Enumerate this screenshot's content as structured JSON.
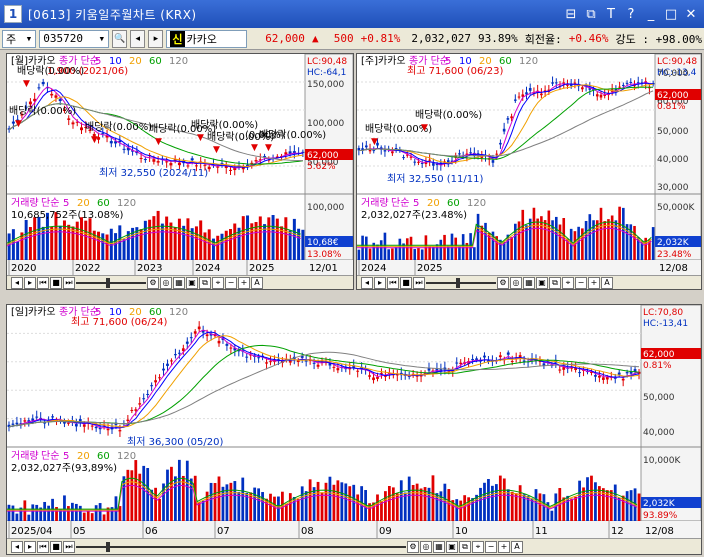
{
  "window": {
    "title": "[0613] 키움일주월차트 (KRX)",
    "app_icon": "1"
  },
  "toolbar": {
    "mode": "주",
    "code": "035720",
    "name": "카카오",
    "name_badge": "신",
    "price": "62,000",
    "arrow": "▲",
    "change": "500",
    "change_pct": "+0.81%",
    "volume": "2,032,027",
    "vol_ratio": "93.89%",
    "turnover_label": "회전율:",
    "turnover": "+0.46%",
    "strength": "강도 : +98.00%"
  },
  "colors": {
    "up": "#e00000",
    "down": "#0030c0",
    "ma5": "#d000d0",
    "ma10": "#0000ff",
    "ma20": "#f0a000",
    "ma60": "#00a000",
    "ma120": "#808080"
  },
  "panels": {
    "monthly": {
      "legend": "[월]카카오",
      "ma_label": "종가 단순",
      "ma": [
        "5",
        "10",
        "20",
        "60",
        "120"
      ],
      "hi_text": "1,900 (2021/06)",
      "lc": "LC:90,48",
      "hc": "HC:-64,1",
      "axis": [
        "150,000",
        "100,000",
        "50,000"
      ],
      "price_tag": "62,000",
      "pct_tag": "5.62%",
      "low_text": "최저 32,550 (2024/11)",
      "div_labels": [
        "배당락(0.00%)",
        "배당락(0.00%)",
        "배당락(0.00%)",
        "배당락(0.00%)",
        "배당락(0.00%)",
        "배당락(0.00%)",
        "(0.00%)",
        "배당락(0.00%)"
      ],
      "vol_legend": "거래량",
      "vol_ma_label": "단순",
      "vol_ma": [
        "5",
        "20",
        "60",
        "120"
      ],
      "vol_text": "10,685,752주(13.08%)",
      "vol_axis": "100,000",
      "vol_tag": "10,68€",
      "vol_pct": "13.08%",
      "dates": [
        "2020",
        "2022",
        "2023",
        "2024",
        "2025"
      ],
      "date_tag": "12/01"
    },
    "weekly": {
      "legend": "[주]카카오",
      "ma_label": "종가 단순",
      "ma": [
        "5",
        "10",
        "20",
        "60",
        "120"
      ],
      "hi_text": "최고 71,600 (06/23)",
      "lc": "LC:90,48",
      "hc": "HC:-13,4",
      "axis": [
        "70,000",
        "60,000",
        "50,000",
        "40,000",
        "30,000"
      ],
      "price_tag": "62,000",
      "pct_tag": "0.81%",
      "low_text": "최저 32,550 (11/11)",
      "div_labels": [
        "배당락(0.00%)",
        "배당락(0.00%)"
      ],
      "vol_legend": "거래량",
      "vol_ma_label": "단순",
      "vol_ma": [
        "5",
        "20",
        "60",
        "120"
      ],
      "vol_text": "2,032,027주(23.48%)",
      "vol_axis": "50,000K",
      "vol_tag": "2,032K",
      "vol_pct": "23.48%",
      "dates": [
        "2024",
        "2025"
      ],
      "date_tag": "12/08"
    },
    "daily": {
      "legend": "[일]카카오",
      "ma_label": "종가 단순",
      "ma": [
        "5",
        "10",
        "20",
        "60",
        "120"
      ],
      "hi_text": "최고 71,600 (06/24)",
      "lc": "LC:70,80",
      "hc": "HC:-13,41",
      "axis": [
        "50,000",
        "40,000"
      ],
      "price_tag": "62,000",
      "pct_tag": "0.81%",
      "low_text": "최저 36,300 (05/20)",
      "vol_legend": "거래량",
      "vol_ma_label": "단순",
      "vol_ma": [
        "5",
        "20",
        "60",
        "120"
      ],
      "vol_text": "2,032,027주(93,89%)",
      "vol_axis": "10,000K",
      "vol_tag": "2,032K",
      "vol_pct": "93.89%",
      "dates": [
        "2025/04",
        "05",
        "06",
        "07",
        "08",
        "09",
        "10",
        "11",
        "12"
      ],
      "date_tag": "12/08"
    }
  }
}
